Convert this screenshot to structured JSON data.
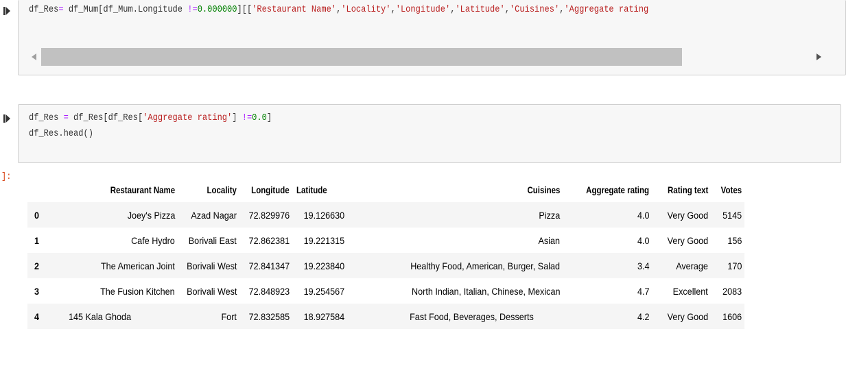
{
  "cells": [
    {
      "lines": [
        [
          {
            "t": "df_Res",
            "c": ""
          },
          {
            "t": "=",
            "c": "op"
          },
          {
            "t": " df_Mum[df_Mum.Longitude ",
            "c": ""
          },
          {
            "t": "!=",
            "c": "op"
          },
          {
            "t": "0.000000",
            "c": "num"
          },
          {
            "t": "][[",
            "c": ""
          },
          {
            "t": "'Restaurant Name'",
            "c": "str"
          },
          {
            "t": ",",
            "c": ""
          },
          {
            "t": "'Locality'",
            "c": "str"
          },
          {
            "t": ",",
            "c": ""
          },
          {
            "t": "'Longitude'",
            "c": "str"
          },
          {
            "t": ",",
            "c": ""
          },
          {
            "t": "'Latitude'",
            "c": "str"
          },
          {
            "t": ",",
            "c": ""
          },
          {
            "t": "'Cuisines'",
            "c": "str"
          },
          {
            "t": ",",
            "c": ""
          },
          {
            "t": "'Aggregate rating",
            "c": "str"
          }
        ]
      ]
    },
    {
      "lines": [
        [
          {
            "t": "df_Res ",
            "c": ""
          },
          {
            "t": "=",
            "c": "op"
          },
          {
            "t": " df_Res[df_Res[",
            "c": ""
          },
          {
            "t": "'Aggregate rating'",
            "c": "str"
          },
          {
            "t": "] ",
            "c": ""
          },
          {
            "t": "!=",
            "c": "op"
          },
          {
            "t": "0.0",
            "c": "num"
          },
          {
            "t": "]",
            "c": ""
          }
        ],
        [
          {
            "t": "df_Res.head()",
            "c": ""
          }
        ]
      ]
    }
  ],
  "output": {
    "prompt": "]:",
    "columns": [
      "Restaurant Name",
      "Locality",
      "Longitude",
      "Latitude",
      "Cuisines",
      "Aggregate rating",
      "Rating text",
      "Votes"
    ],
    "rows": [
      {
        "index": "0",
        "values": [
          "Joey's Pizza",
          "Azad Nagar",
          "72.829976",
          "19.126630",
          "Pizza",
          "4.0",
          "Very Good",
          "5145"
        ]
      },
      {
        "index": "1",
        "values": [
          "Cafe Hydro",
          "Borivali East",
          "72.862381",
          "19.221315",
          "Asian",
          "4.0",
          "Very Good",
          "156"
        ]
      },
      {
        "index": "2",
        "values": [
          "The American Joint",
          "Borivali West",
          "72.841347",
          "19.223840",
          "Healthy Food, American, Burger, Salad",
          "3.4",
          "Average",
          "170"
        ]
      },
      {
        "index": "3",
        "values": [
          "The Fusion Kitchen",
          "Borivali West",
          "72.848923",
          "19.254567",
          "North Indian, Italian, Chinese, Mexican",
          "4.7",
          "Excellent",
          "2083"
        ]
      },
      {
        "index": "4",
        "values": [
          "145 Kala Ghoda",
          "Fort",
          "72.832585",
          "18.927584",
          "Fast Food, Beverages, Desserts",
          "4.2",
          "Very Good",
          "1606"
        ]
      }
    ]
  },
  "icons": {
    "run": "run-cell-icon",
    "scroll_left": "chevron-left-icon",
    "scroll_right": "chevron-right-icon"
  },
  "colors": {
    "string": "#ba2121",
    "number": "#008000",
    "operator": "#aa22ff",
    "prompt": "#d84315",
    "input_bg": "#f7f7f7"
  }
}
